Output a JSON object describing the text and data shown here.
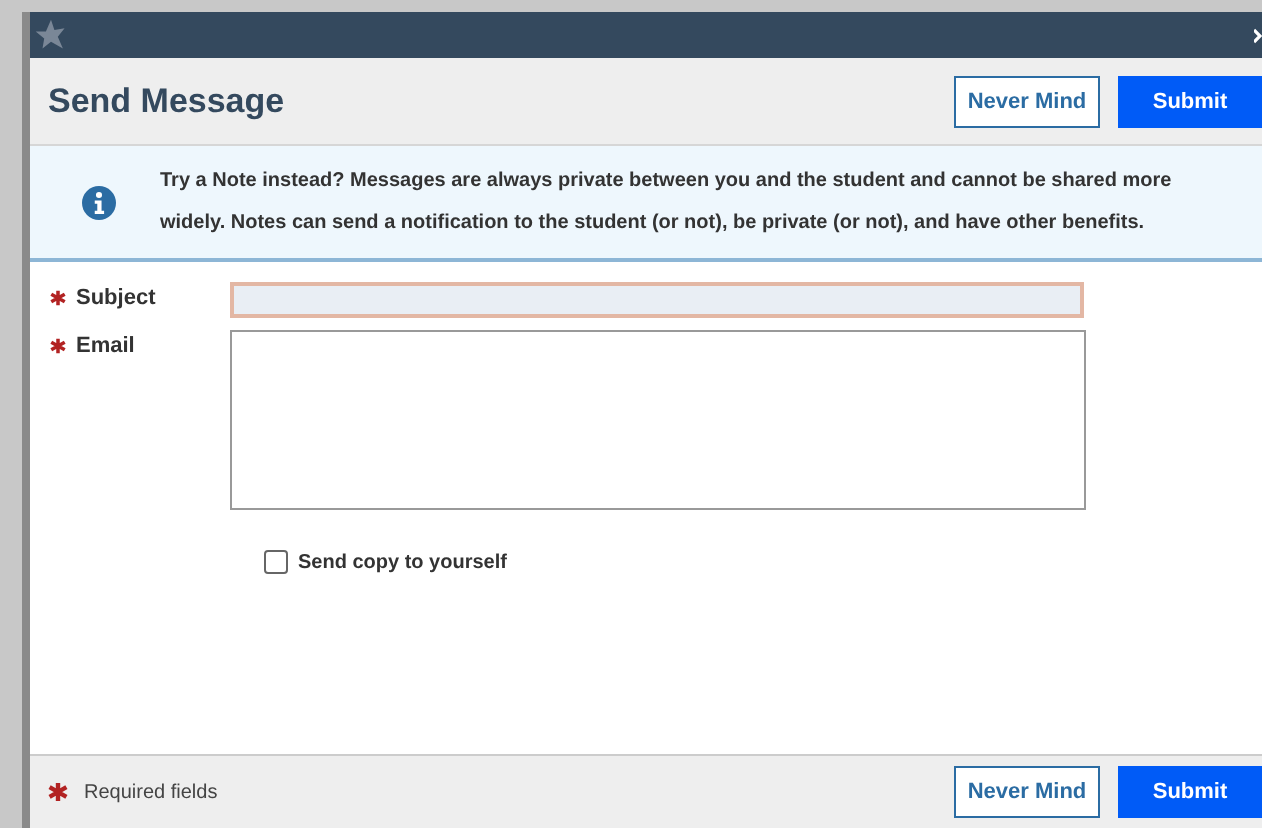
{
  "header": {
    "title": "Send Message",
    "buttons": [
      {
        "label": "Never Mind",
        "kind": "secondary"
      },
      {
        "label": "Submit",
        "kind": "primary"
      }
    ]
  },
  "notice": {
    "text": "Try a Note instead? Messages are always private between you and the student and cannot be shared more widely. Notes can send a notification to the student (or not), be private (or not), and have other benefits."
  },
  "fields": [
    {
      "label": "Subject",
      "required": true,
      "kind": "text",
      "focused": true
    },
    {
      "label": "Email",
      "required": true,
      "kind": "textarea",
      "focused": false
    }
  ],
  "copy_checkbox": {
    "label": "Send copy to yourself",
    "checked": false
  },
  "footer": {
    "legend": "Required fields",
    "buttons": [
      {
        "label": "Never Mind",
        "kind": "secondary"
      },
      {
        "label": "Submit",
        "kind": "primary"
      }
    ]
  }
}
